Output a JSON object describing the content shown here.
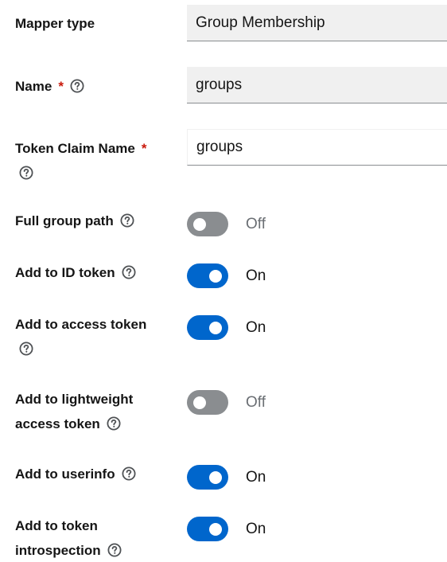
{
  "fields": {
    "mapper_type": {
      "label": "Mapper type",
      "value": "Group Membership"
    },
    "name": {
      "label": "Name",
      "required_mark": "*",
      "value": "groups"
    },
    "token_claim_name": {
      "label": "Token Claim Name",
      "required_mark": "*",
      "value": "groups"
    }
  },
  "toggles": [
    {
      "label": "Full group path",
      "on": false,
      "state_text": "Off"
    },
    {
      "label": "Add to ID token",
      "on": true,
      "state_text": "On"
    },
    {
      "label": "Add to access token",
      "on": true,
      "state_text": "On"
    },
    {
      "label": "Add to lightweight access token",
      "on": false,
      "state_text": "Off"
    },
    {
      "label": "Add to userinfo",
      "on": true,
      "state_text": "On"
    },
    {
      "label": "Add to token introspection",
      "on": true,
      "state_text": "On"
    }
  ],
  "colors": {
    "toggle_on": "#0066cc",
    "toggle_off": "#8a8d90",
    "required": "#c9190b",
    "readonly_bg": "#f0f0f0"
  },
  "icons": {
    "help": "help-circle-icon"
  }
}
